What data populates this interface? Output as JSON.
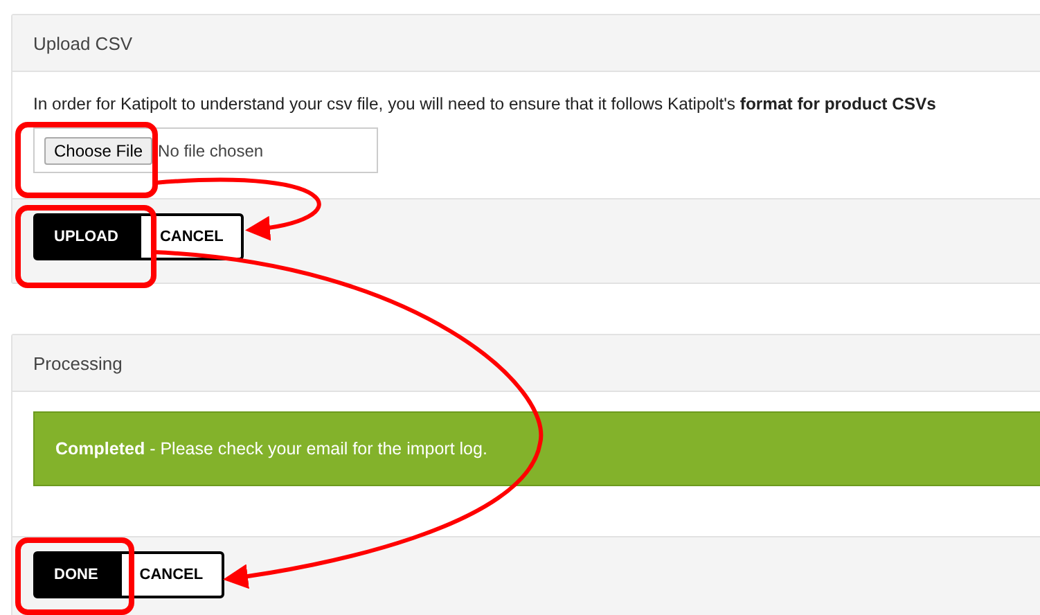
{
  "panels": [
    {
      "title": "Upload CSV",
      "description": "In order for Katipolt to understand your csv file, you will need to ensure that it follows Katipolt's **format for product CSVs**",
      "file_input": {
        "button": "Choose File",
        "status": "No file chosen"
      },
      "buttons": [
        {
          "label": "UPLOAD",
          "kind": "primary"
        },
        {
          "label": "CANCEL",
          "kind": "secondary"
        }
      ]
    },
    {
      "title": "Processing",
      "alert": "**Completed** - Please check your email for the import log.",
      "buttons": [
        {
          "label": "DONE",
          "kind": "primary"
        },
        {
          "label": "CANCEL",
          "kind": "secondary"
        }
      ]
    }
  ]
}
